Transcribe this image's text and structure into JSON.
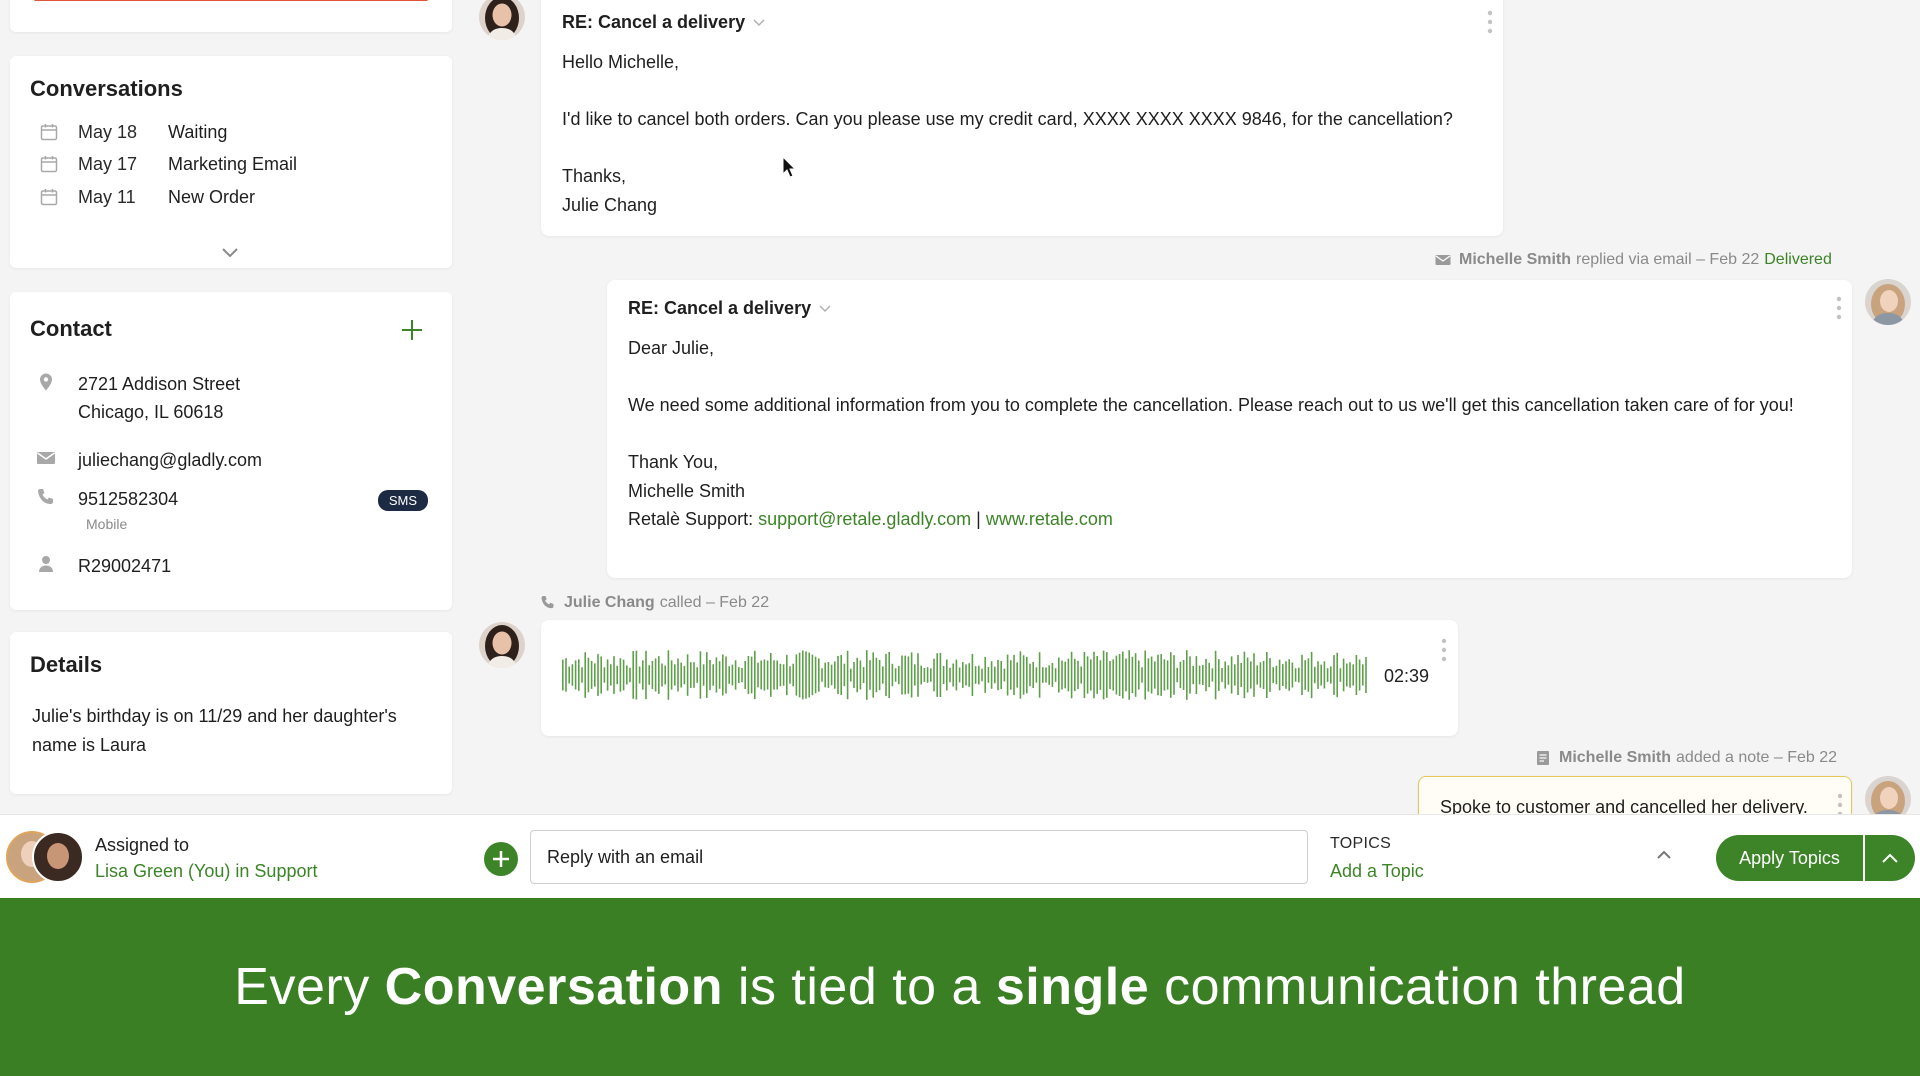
{
  "sidebar": {
    "conversations": {
      "title": "Conversations",
      "items": [
        {
          "date": "May 18",
          "status": "Waiting"
        },
        {
          "date": "May 17",
          "status": "Marketing Email"
        },
        {
          "date": "May 11",
          "status": "New Order"
        }
      ]
    },
    "contact": {
      "title": "Contact",
      "address_line1": "2721 Addison Street",
      "address_line2": "Chicago, IL 60618",
      "email": "juliechang@gladly.com",
      "phone": "9512582304",
      "phone_type": "Mobile",
      "sms_badge": "SMS",
      "customer_id": "R29002471"
    },
    "details": {
      "title": "Details",
      "text": "Julie's birthday is on 11/29 and her daughter's name is Laura"
    }
  },
  "messages": {
    "customer_email": {
      "subject": "RE: Cancel a delivery",
      "greeting": "Hello Michelle,",
      "body": "I'd like to cancel both orders. Can you please use my credit card, XXXX XXXX XXXX 9846, for the cancellation?",
      "signoff": "Thanks,",
      "signature": "Julie Chang"
    },
    "agent_reply_meta": {
      "name": "Michelle Smith",
      "action": "replied via email – Feb 22",
      "status": "Delivered"
    },
    "agent_email": {
      "subject": "RE: Cancel a delivery",
      "greeting": "Dear Julie,",
      "body": "We need some additional information from you to complete the cancellation. Please reach out to us we'll get this cancellation taken care of for you!",
      "signoff": "Thank You,",
      "signature": "Michelle Smith",
      "support_prefix": "Retalè Support:",
      "support_email": "support@retale.gladly.com",
      "separator": "|",
      "support_site": "www.retale.com"
    },
    "call_meta": {
      "name": "Julie Chang",
      "action": "called – Feb 22"
    },
    "call": {
      "duration": "02:39"
    },
    "note_meta": {
      "name": "Michelle Smith",
      "action": "added a note – Feb 22"
    },
    "note": {
      "text": "Spoke to customer and cancelled her delivery."
    }
  },
  "bottom_bar": {
    "assigned_label": "Assigned to",
    "assigned_name": "Lisa Green (You) in Support",
    "reply_placeholder": "Reply with an email",
    "topics_label": "TOPICS",
    "topics_add": "Add a Topic",
    "apply_label": "Apply Topics"
  },
  "banner": {
    "part1": "Every ",
    "bold1": "Conversation",
    "part2": " is tied to a ",
    "bold2": "single",
    "part3": " communication thread"
  },
  "colors": {
    "brand_green": "#3c8427",
    "banner_green": "#3a7f24",
    "sms_badge": "#1d2a44",
    "top_bar_accent": "#e0553a"
  }
}
